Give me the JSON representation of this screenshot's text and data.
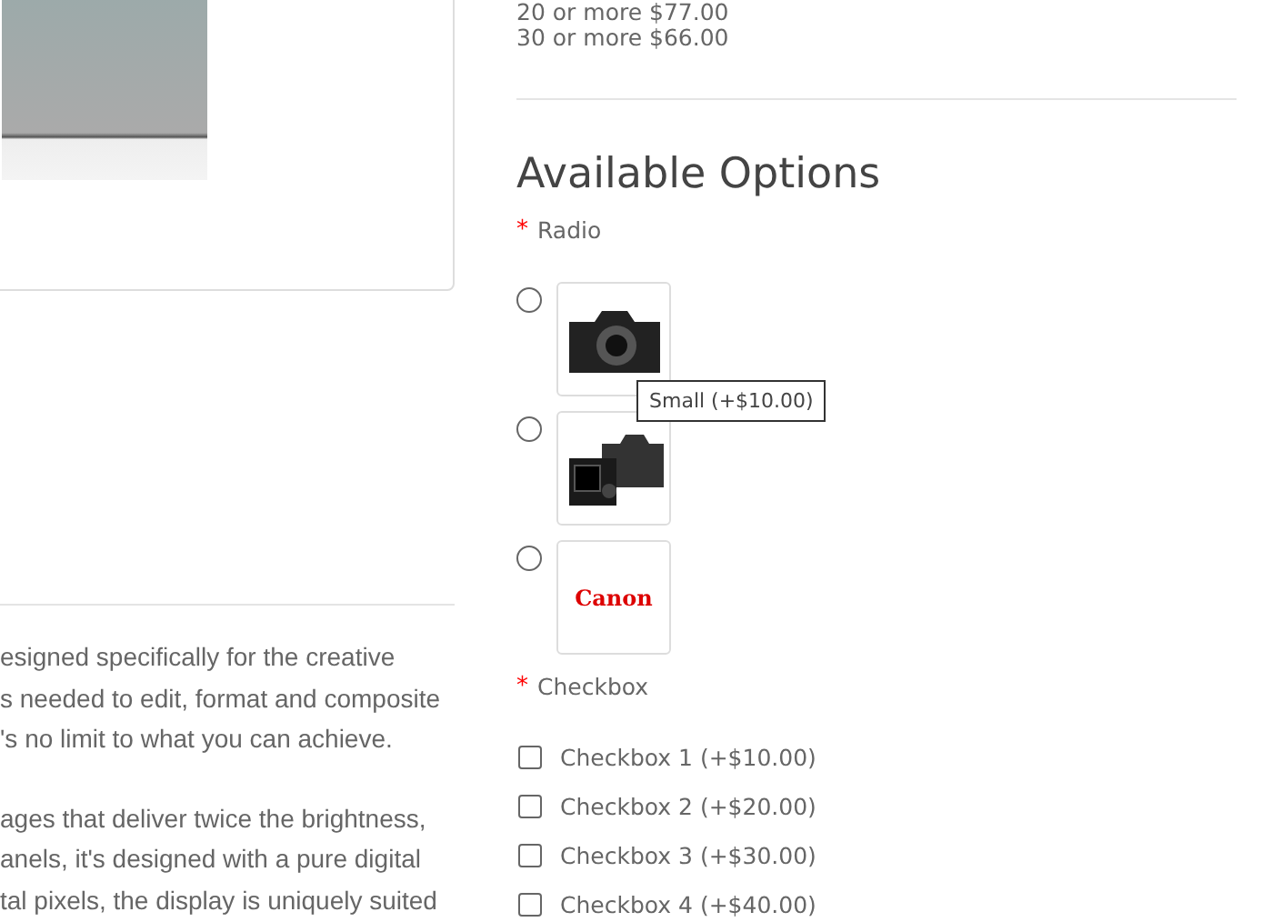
{
  "description": {
    "paragraphs": [
      [
        "esigned specifically for the creative",
        "s needed to edit, format and composite",
        "'s no limit to what you can achieve."
      ],
      [
        "ages that deliver twice the brightness,",
        "anels, it's designed with a pure digital",
        "tal pixels, the display is uniquely suited"
      ]
    ]
  },
  "discounts": [
    "20 or more $77.00",
    "30 or more $66.00"
  ],
  "options": {
    "title": "Available Options",
    "radio": {
      "label": "Radio",
      "required_mark": "*",
      "items": [
        {
          "kind": "camera-front",
          "selected": false
        },
        {
          "kind": "camera-pair",
          "selected": false
        },
        {
          "kind": "logo",
          "logo_text": "Canon",
          "selected": false
        }
      ],
      "tooltip": "Small (+$10.00)"
    },
    "checkbox": {
      "label": "Checkbox",
      "required_mark": "*",
      "items": [
        {
          "label": "Checkbox 1 (+$10.00)",
          "checked": false
        },
        {
          "label": "Checkbox 2 (+$20.00)",
          "checked": false
        },
        {
          "label": "Checkbox 3 (+$30.00)",
          "checked": false
        },
        {
          "label": "Checkbox 4 (+$40.00)",
          "checked": false
        }
      ]
    }
  }
}
